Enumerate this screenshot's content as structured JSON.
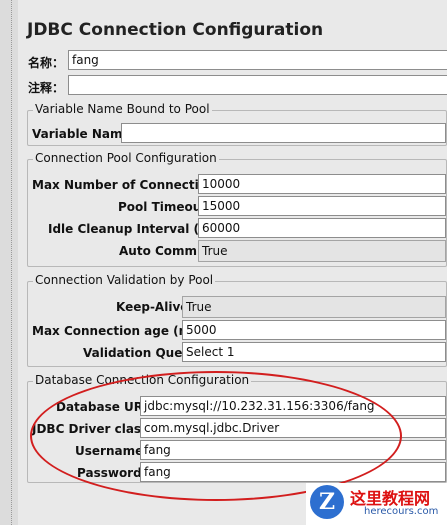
{
  "panel": {
    "title": "JDBC Connection Configuration",
    "name_label": "名称：",
    "name_value": "fang",
    "comment_label": "注释："
  },
  "variable_group": {
    "legend": "Variable Name Bound to Pool",
    "variable_name_label": "Variable Name:",
    "variable_name_value": ""
  },
  "pool_group": {
    "legend": "Connection Pool Configuration",
    "max_connections_label": "Max Number of Connections:",
    "max_connections_value": "10000",
    "pool_timeout_label": "Pool Timeout:",
    "pool_timeout_value": "15000",
    "idle_cleanup_label": "Idle Cleanup Interval (ms):",
    "idle_cleanup_value": "60000",
    "auto_commit_label": "Auto Commit:",
    "auto_commit_value": "True"
  },
  "validation_group": {
    "legend": "Connection Validation by Pool",
    "keep_alive_label": "Keep-Alive:",
    "keep_alive_value": "True",
    "max_age_label": "Max Connection age (ms):",
    "max_age_value": "5000",
    "validation_query_label": "Validation Query:",
    "validation_query_value": "Select 1"
  },
  "database_group": {
    "legend": "Database Connection Configuration",
    "url_label": "Database URL:",
    "url_value": "jdbc:mysql://10.232.31.156:3306/fang",
    "driver_label": "JDBC Driver class:",
    "driver_value": "com.mysql.jdbc.Driver",
    "username_label": "Username:",
    "username_value": "fang",
    "password_label": "Password:",
    "password_value": "fang"
  },
  "watermark": {
    "letter": "Z",
    "chinese": "这里教程网",
    "domain": "herecours.com"
  },
  "colors": {
    "annotation_oval": "#d21e1e",
    "panel_background": "#e9e9e9"
  }
}
